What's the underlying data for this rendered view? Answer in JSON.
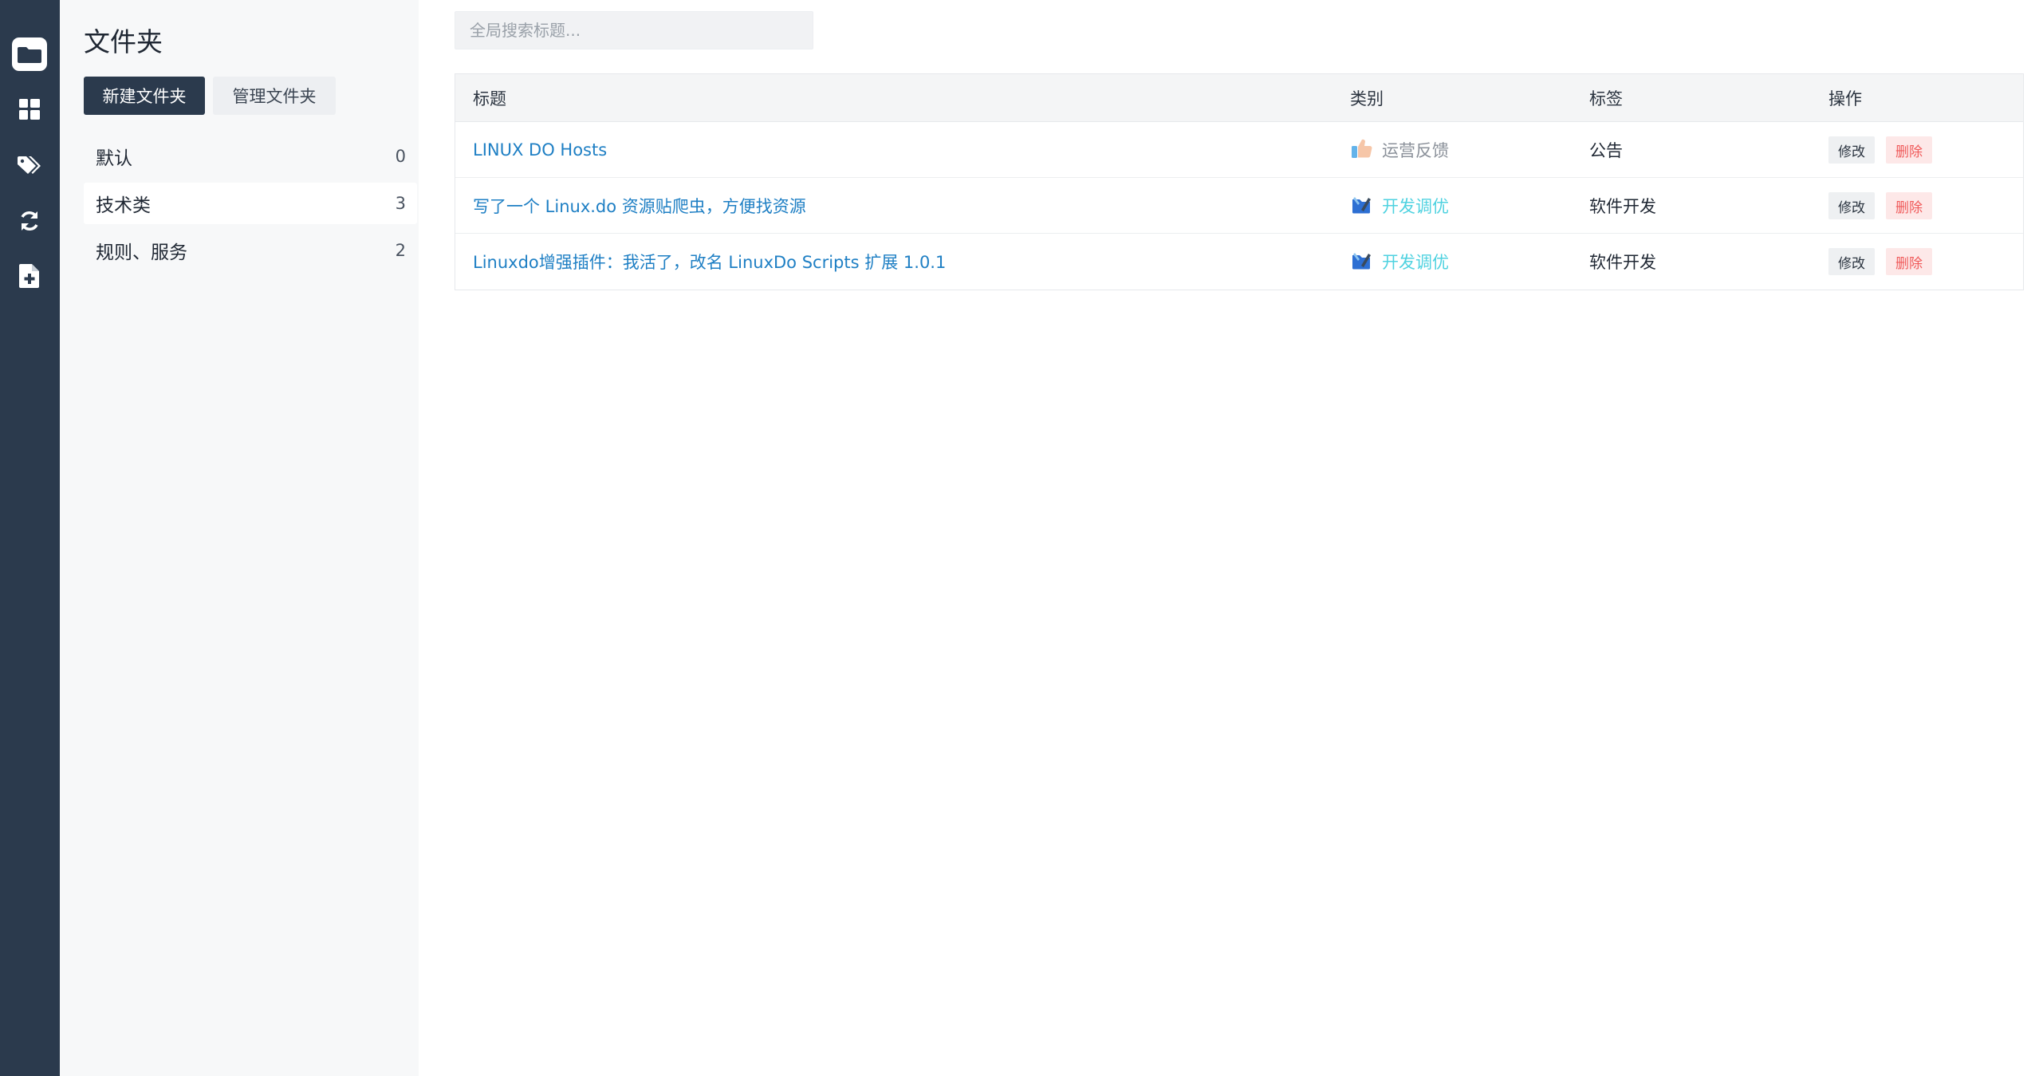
{
  "rail": {
    "icons": [
      "folder-icon",
      "dashboard-icon",
      "tags-icon",
      "sync-icon",
      "add-file-icon"
    ]
  },
  "folders": {
    "title": "文件夹",
    "new_button": "新建文件夹",
    "manage_button": "管理文件夹",
    "items": [
      {
        "name": "默认",
        "count": "0"
      },
      {
        "name": "技术类",
        "count": "3"
      },
      {
        "name": "规则、服务",
        "count": "2"
      }
    ],
    "active_index": 1
  },
  "search": {
    "placeholder": "全局搜索标题..."
  },
  "table": {
    "headers": {
      "title": "标题",
      "category": "类别",
      "tag": "标签",
      "actions": "操作"
    },
    "rows": [
      {
        "title": "LINUX DO Hosts",
        "category": "运营反馈",
        "category_icon": "thumbs-up-icon",
        "category_color": "#8a9099",
        "tag": "公告",
        "edit": "修改",
        "delete": "删除"
      },
      {
        "title": "写了一个 Linux.do 资源贴爬虫，方便找资源",
        "category": "开发调优",
        "category_icon": "dev-tools-icon",
        "category_color": "#4fd2e0",
        "tag": "软件开发",
        "edit": "修改",
        "delete": "删除"
      },
      {
        "title": "Linuxdo增强插件：我活了，改名 LinuxDo Scripts 扩展 1.0.1",
        "category": "开发调优",
        "category_icon": "dev-tools-icon",
        "category_color": "#4fd2e0",
        "tag": "软件开发",
        "edit": "修改",
        "delete": "删除"
      }
    ]
  },
  "colors": {
    "rail_bg": "#2b3a4d",
    "link": "#1e7fc4",
    "delete_text": "#f05a5a"
  }
}
